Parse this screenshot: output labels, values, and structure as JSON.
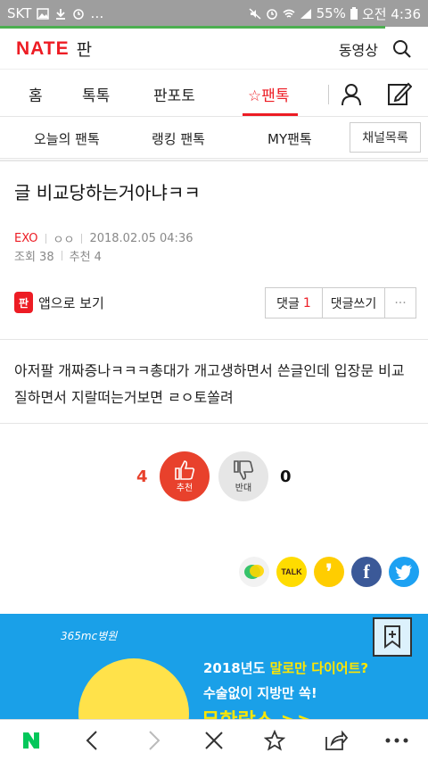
{
  "status": {
    "carrier": "SKT",
    "battery": "55%",
    "time": "오전 4:36",
    "page_load_progress": 0.9
  },
  "header": {
    "logo": "NATE",
    "logo_suffix": "판",
    "video": "동영상",
    "icons": [
      "search-icon"
    ]
  },
  "nav": {
    "items": [
      {
        "label": "홈"
      },
      {
        "label": "톡톡"
      },
      {
        "label": "판포토"
      },
      {
        "label": "☆팬톡"
      }
    ],
    "active": "☆팬톡",
    "icons": [
      "user-icon",
      "write-icon"
    ]
  },
  "subnav": {
    "items": [
      {
        "label": "오늘의 팬톡"
      },
      {
        "label": "랭킹 팬톡"
      },
      {
        "label": "MY팬톡"
      }
    ],
    "channel_list": "채널목록"
  },
  "article": {
    "title": "글 비교당하는거아냐ㅋㅋ",
    "category": "EXO",
    "author": "ㅇㅇ",
    "date": "2018.02.05 04:36",
    "views": "조회 38",
    "recommends": "추천 4",
    "app_badge": "판",
    "app_view": "앱으로 보기",
    "comment_label": "댓글",
    "comment_count": "1",
    "write_comment": "댓글쓰기",
    "more": "···",
    "body": "아저팔 개짜증나ㅋㅋㅋ총대가 개고생하면서 쓴글인데 입장문 비교질하면서 지랄떠는거보면 ㄹㅇ토쏠려"
  },
  "votes": {
    "up_count": "4",
    "up_label": "추천",
    "down_count": "0",
    "down_label": "반대"
  },
  "share": {
    "kakao": "TALK",
    "story": "❜",
    "facebook": "f",
    "icons": [
      "line-icon",
      "kakaotalk-icon",
      "kakaostory-icon",
      "facebook-icon",
      "twitter-icon"
    ]
  },
  "ad": {
    "brand": "365mc병원",
    "line1_prefix": "2018년도 ",
    "line1_highlight": "말로만 다이어트?",
    "line2": "수술없이 지방만 쏙!",
    "line3": "무한람스 >>"
  },
  "colors": {
    "accent": "#ed1c24",
    "vote_up": "#e8412c",
    "naver_green": "#03c75a",
    "ad_bg": "#1aa0e8"
  }
}
